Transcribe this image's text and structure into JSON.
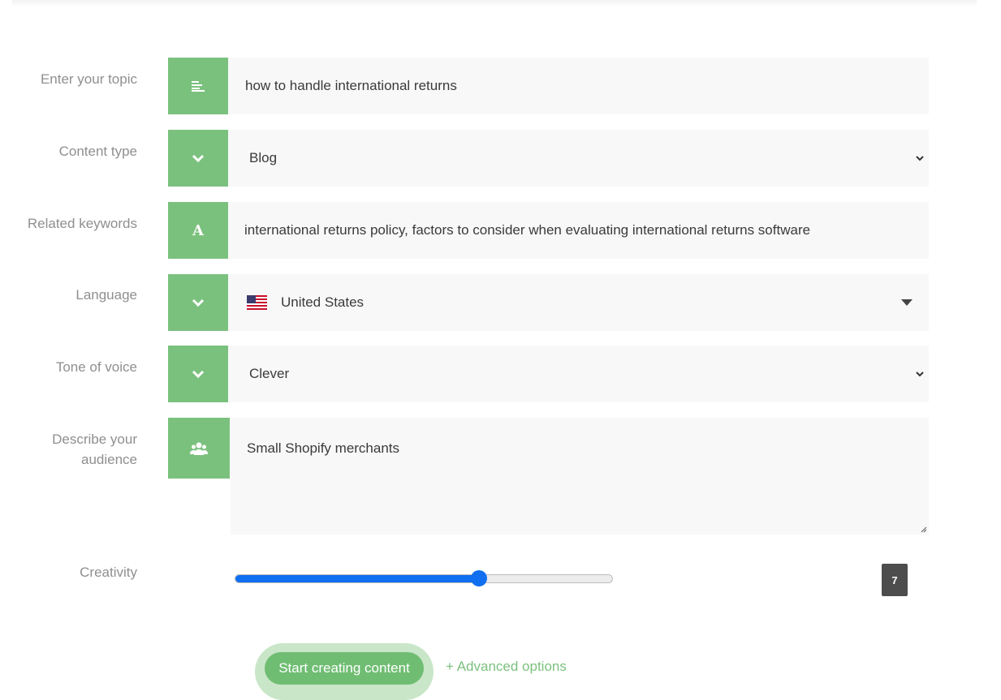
{
  "form": {
    "topic": {
      "label": "Enter your topic",
      "value": "how to handle international returns",
      "icon": "text-lines-icon"
    },
    "content_type": {
      "label": "Content type",
      "value": "Blog",
      "icon": "chevron-down-icon"
    },
    "keywords": {
      "label": "Related keywords",
      "value": "international returns policy, factors to consider when evaluating international returns software",
      "icon": "letter-a-icon"
    },
    "language": {
      "label": "Language",
      "value": "United States",
      "icon": "chevron-down-icon",
      "flag": "us-flag-icon"
    },
    "tone": {
      "label": "Tone of voice",
      "value": "Clever",
      "icon": "chevron-down-icon"
    },
    "audience": {
      "label_line1": "Describe your",
      "label_line2": "audience",
      "value": "Small Shopify merchants",
      "icon": "users-icon"
    },
    "creativity": {
      "label": "Creativity",
      "value": "7",
      "min": 0,
      "max": 10,
      "fill_fraction": 0.645
    }
  },
  "actions": {
    "start_label": "Start creating content",
    "advanced_label": "+ Advanced options"
  },
  "colors": {
    "accent_green": "#7bc17e",
    "slider_blue": "#0f6ff0",
    "field_bg": "#f8f8f8",
    "label_gray": "#8f8f8f"
  }
}
